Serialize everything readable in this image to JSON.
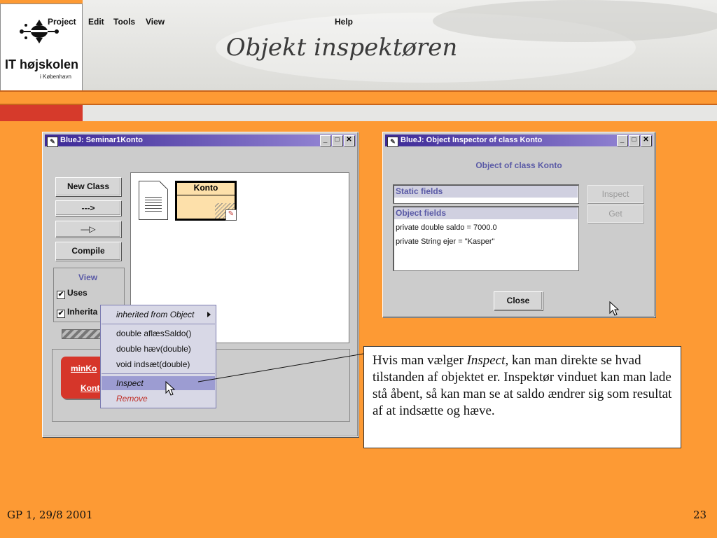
{
  "slide": {
    "title": "Objekt inspektøren",
    "logo_main": "IT højskolen",
    "logo_sub": "i København",
    "footer_left": "GP 1, 29/8 2001",
    "page_number": "23"
  },
  "main_window": {
    "title": "BlueJ:  Seminar1Konto",
    "menu": [
      "Project",
      "Edit",
      "Tools",
      "View"
    ],
    "help": "Help",
    "buttons": {
      "new_class": "New Class",
      "dashed_arrow": "--->",
      "solid_arrow": "—▷",
      "compile": "Compile"
    },
    "view_group": {
      "label": "View",
      "uses": "Uses",
      "inheritance": "Inherita"
    },
    "class_name": "Konto",
    "object": {
      "name": "minKo",
      "type": "Kont"
    },
    "context_menu": {
      "inherited": "inherited from Object",
      "items": [
        "double aflæsSaldo()",
        "double hæv(double)",
        "void indsæt(double)"
      ],
      "inspect": "Inspect",
      "remove": "Remove"
    }
  },
  "inspector": {
    "title": "BlueJ:  Object Inspector of class Konto",
    "heading": "Object of class Konto",
    "static_fields": "Static fields",
    "object_fields": "Object fields",
    "fields": [
      "private double saldo = 7000.0",
      "private String ejer = \"Kasper\""
    ],
    "inspect_button": "Inspect",
    "get_button": "Get",
    "close_button": "Close"
  },
  "note": {
    "before": "Hvis man vælger ",
    "emph": "Inspect",
    "after": ", kan man direkte se hvad tilstanden af objektet er. Inspektør vinduet kan man lade stå åbent, så kan man se at saldo ændrer sig som resultat af at indsætte og hæve."
  },
  "colors": {
    "background": "#fd9a34",
    "titlebar_start": "#3c2896",
    "object_red": "#d6362a",
    "menu_highlight": "#9c9cd2"
  }
}
